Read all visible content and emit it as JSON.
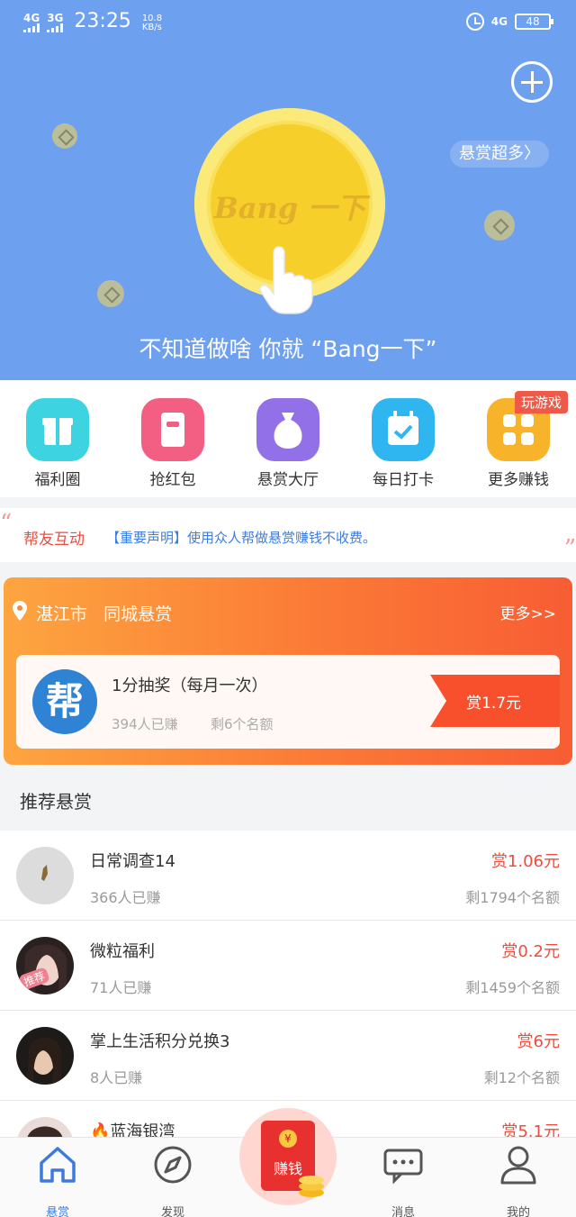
{
  "status_bar": {
    "sig1": "4G",
    "sig2": "3G",
    "time": "23:25",
    "speed_value": "10.8",
    "speed_unit": "KB/s",
    "net": "4G",
    "battery": "48"
  },
  "hero": {
    "coin_text": "Bang 一下",
    "more_reward": "悬赏超多〉",
    "slogan": "不知道做啥 你就 “Bang一下”"
  },
  "quick_menu": [
    {
      "label": "福利圈",
      "icon": "gift-icon",
      "color": "#3dd3e0"
    },
    {
      "label": "抢红包",
      "icon": "red-packet-icon",
      "color": "#f35f83"
    },
    {
      "label": "悬赏大厅",
      "icon": "money-bag-icon",
      "color": "#9270e8"
    },
    {
      "label": "每日打卡",
      "icon": "calendar-check-icon",
      "color": "#2fb5f0"
    },
    {
      "label": "更多赚钱",
      "icon": "grid-icon",
      "color": "#f7b42a"
    }
  ],
  "quick_tag": "玩游戏",
  "notice": {
    "title": "帮友互动",
    "text": "【重要声明】使用众人帮做悬赏赚钱不收费。"
  },
  "city": {
    "city_name": "湛江市",
    "title": "同城悬赏",
    "more": "更多>>",
    "task": {
      "logo_char": "帮",
      "name": "1分抽奖（每月一次）",
      "earned": "394人已赚",
      "remaining": "剩6个名额",
      "reward": "赏1.7元"
    }
  },
  "recommend": {
    "title": "推荐悬赏",
    "tag": "推荐",
    "items": [
      {
        "name": "日常调查14",
        "earned": "366人已赚",
        "reward": "赏1.06元",
        "remaining": "剩1794个名额"
      },
      {
        "name": "微粒福利",
        "earned": "71人已赚",
        "reward": "赏0.2元",
        "remaining": "剩1459个名额"
      },
      {
        "name": "掌上生活积分兑换3",
        "earned": "8人已赚",
        "reward": "赏6元",
        "remaining": "剩12个名额"
      },
      {
        "name": "🔥蓝海银湾",
        "earned": "",
        "reward": "赏5.1元",
        "remaining": ""
      }
    ]
  },
  "tabs": [
    {
      "label": "悬赏",
      "icon": "home-icon",
      "active": true
    },
    {
      "label": "发现",
      "icon": "compass-icon",
      "active": false
    },
    {
      "label": "赚钱",
      "icon": "red-envelope-icon",
      "active": false
    },
    {
      "label": "消息",
      "icon": "chat-icon",
      "active": false
    },
    {
      "label": "我的",
      "icon": "user-icon",
      "active": false
    }
  ],
  "colors": {
    "hero_bg": "#6ea0f0",
    "accent_red": "#ee4c3c",
    "link_blue": "#3b7de0",
    "orange_card": "#fb7a36"
  }
}
